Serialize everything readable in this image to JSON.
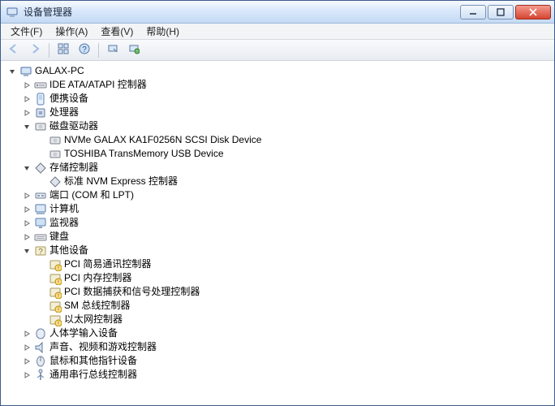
{
  "window": {
    "title": "设备管理器"
  },
  "menu": {
    "file": "文件(F)",
    "action": "操作(A)",
    "view": "查看(V)",
    "help": "帮助(H)"
  },
  "toolbar": {
    "back_icon": "back-icon",
    "forward_icon": "forward-icon",
    "view_icon": "view-icon",
    "help_icon": "help-icon",
    "refresh_icon": "refresh-icon"
  },
  "tree": {
    "root": {
      "label": "GALAX-PC"
    },
    "ide": {
      "label": "IDE ATA/ATAPI 控制器"
    },
    "portable": {
      "label": "便携设备"
    },
    "processors": {
      "label": "处理器"
    },
    "disk_drives": {
      "label": "磁盘驱动器"
    },
    "disk_nvme": {
      "label": "NVMe GALAX KA1F0256N SCSI Disk Device"
    },
    "disk_usb": {
      "label": "TOSHIBA TransMemory USB Device"
    },
    "storage_ctrl": {
      "label": "存储控制器"
    },
    "storage_nvm": {
      "label": "标准 NVM Express 控制器"
    },
    "ports": {
      "label": "端口 (COM 和 LPT)"
    },
    "computer": {
      "label": "计算机"
    },
    "monitors": {
      "label": "监视器"
    },
    "keyboards": {
      "label": "键盘"
    },
    "other": {
      "label": "其他设备"
    },
    "other_pci_comm": {
      "label": "PCI 简易通讯控制器"
    },
    "other_pci_mem": {
      "label": "PCI 内存控制器"
    },
    "other_pci_data": {
      "label": "PCI 数据捕获和信号处理控制器"
    },
    "other_sm_bus": {
      "label": "SM 总线控制器"
    },
    "other_ethernet": {
      "label": "以太网控制器"
    },
    "hid": {
      "label": "人体学输入设备"
    },
    "sound": {
      "label": "声音、视频和游戏控制器"
    },
    "mouse": {
      "label": "鼠标和其他指针设备"
    },
    "usb": {
      "label": "通用串行总线控制器"
    }
  }
}
